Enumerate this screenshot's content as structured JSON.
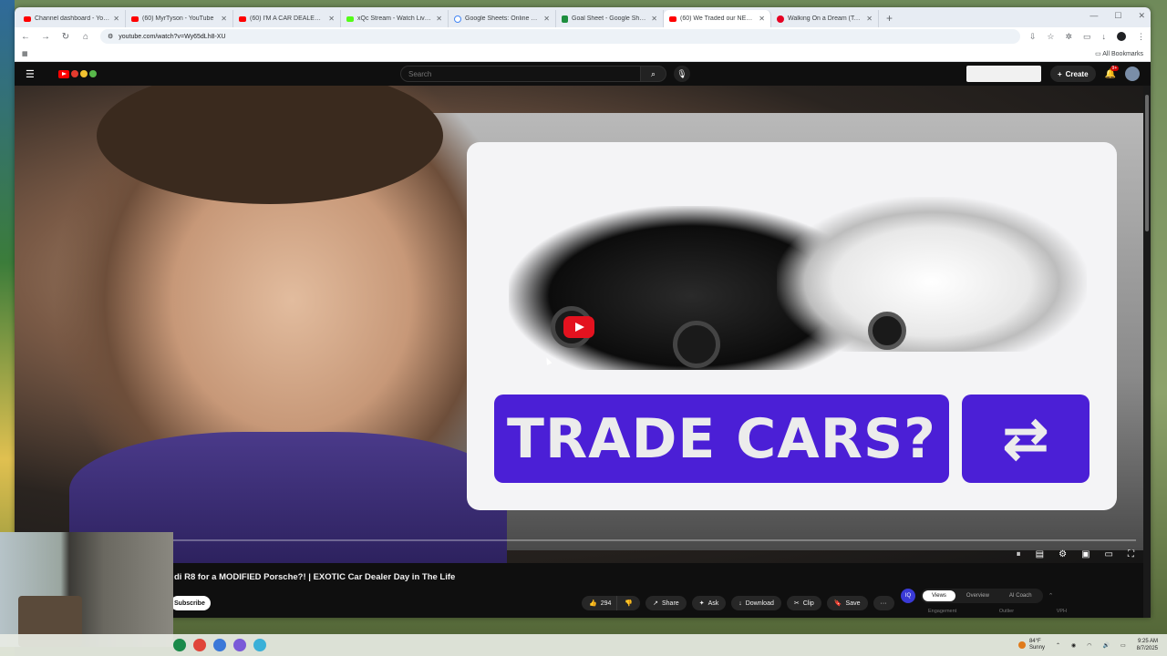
{
  "browser": {
    "tabs": [
      {
        "title": "Channel dashboard - YouTube",
        "icon": "youtube-icon",
        "active": false
      },
      {
        "title": "(60) MyrTyson - YouTube",
        "icon": "youtube-icon",
        "active": false
      },
      {
        "title": "(60) I'M A CAR DEALER - This is...",
        "icon": "youtube-icon",
        "active": false
      },
      {
        "title": "xQc Stream - Watch Live on...",
        "icon": "kick-icon",
        "active": false
      },
      {
        "title": "Google Sheets: Online Spreadsh...",
        "icon": "google-icon",
        "active": false
      },
      {
        "title": "Goal Sheet - Google Sheets",
        "icon": "sheets-icon",
        "active": false
      },
      {
        "title": "(60) We Traded our NEW Audi...",
        "icon": "youtube-icon",
        "active": true
      },
      {
        "title": "Walking On a Dream (Tech...",
        "icon": "pinterest-icon",
        "active": false
      }
    ],
    "url": "youtube.com/watch?v=Wy65dLh8-XU",
    "bookmarks_label": "All Bookmarks"
  },
  "youtube": {
    "search_placeholder": "Search",
    "create_label": "Create",
    "notification_count": "9+"
  },
  "thumbnail": {
    "headline": "TRADE CARS?",
    "swap_symbol": "⇄"
  },
  "video": {
    "title": "di R8 for a MODIFIED Porsche?! | EXOTIC Car Dealer Day in The Life",
    "subscribe_label": "Subscribe",
    "like_count": "294",
    "share_label": "Share",
    "ask_label": "Ask",
    "download_label": "Download",
    "clip_label": "Clip",
    "save_label": "Save",
    "more_label": "···"
  },
  "vidiq": {
    "logo": "IQ",
    "tabs": [
      "Views",
      "Overview",
      "AI Coach"
    ],
    "sub_labels": [
      "Engagement",
      "Outlier",
      "VPH"
    ]
  },
  "taskbar": {
    "temperature": "84°F",
    "weather": "Sunny",
    "time": "9:25 AM",
    "date": "8/7/2025"
  },
  "colors": {
    "youtube_red": "#ff0000",
    "thumbnail_purple": "#4b1fd6",
    "page_bg": "#0f0f0f"
  }
}
